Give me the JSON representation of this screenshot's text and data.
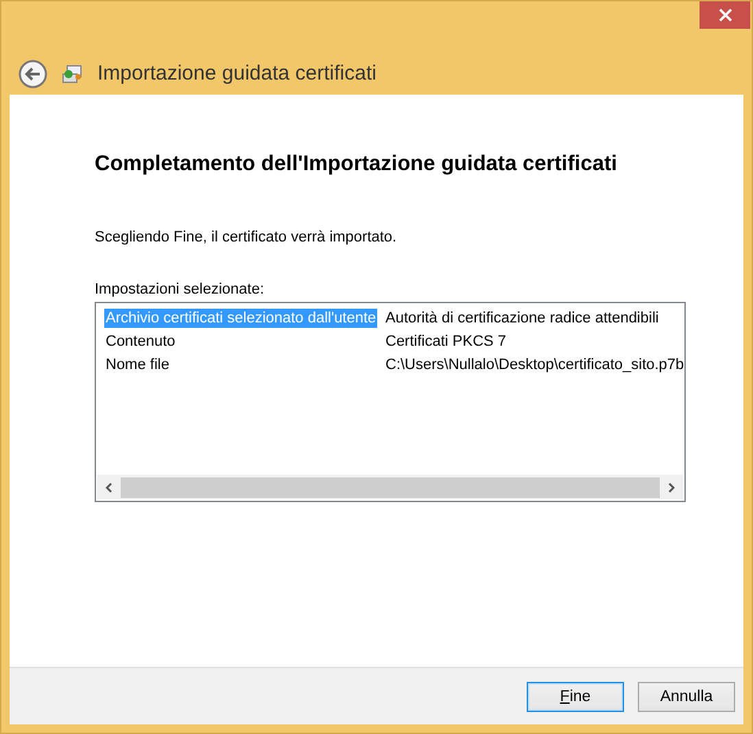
{
  "window": {
    "title": "Importazione guidata certificati"
  },
  "heading": "Completamento dell'Importazione guidata certificati",
  "description": "Scegliendo Fine, il certificato verrà importato.",
  "settings": {
    "label": "Impostazioni selezionate:",
    "rows": [
      {
        "name": "Archivio certificati selezionato dall'utente",
        "value": "Autorità di certificazione radice attendibili",
        "selected": true
      },
      {
        "name": "Contenuto",
        "value": "Certificati PKCS 7",
        "selected": false
      },
      {
        "name": "Nome file",
        "value": "C:\\Users\\Nullalo\\Desktop\\certificato_sito.p7b",
        "selected": false
      }
    ]
  },
  "buttons": [
    {
      "label": "Fine",
      "kind": "default"
    },
    {
      "label": "Annulla",
      "kind": "normal"
    }
  ]
}
